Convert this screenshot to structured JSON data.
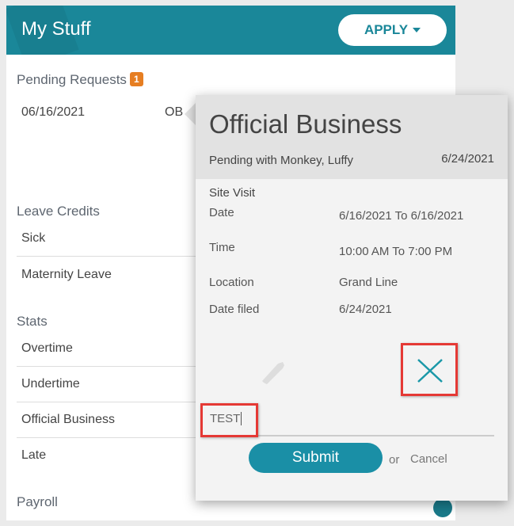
{
  "header": {
    "title": "My Stuff",
    "apply_label": "APPLY"
  },
  "pending": {
    "title": "Pending Requests",
    "count": "1",
    "items": [
      {
        "date": "06/16/2021",
        "type": "OB"
      }
    ]
  },
  "leave_credits": {
    "title": "Leave Credits",
    "items": [
      "Sick",
      "Maternity Leave"
    ]
  },
  "stats": {
    "title": "Stats",
    "items": [
      "Overtime",
      "Undertime",
      "Official Business",
      "Late"
    ]
  },
  "payroll": {
    "title": "Payroll"
  },
  "popup": {
    "title": "Official Business",
    "status": "Pending with Monkey, Luffy",
    "filed_date": "6/24/2021",
    "subtitle": "Site Visit",
    "fields": [
      {
        "label": "Date",
        "value": "6/16/2021 To 6/16/2021"
      },
      {
        "label": "Time",
        "value": "10:00 AM To 7:00 PM"
      },
      {
        "label": "Location",
        "value": "Grand Line"
      },
      {
        "label": "Date filed",
        "value": "6/24/2021"
      }
    ],
    "comment_value": "TEST",
    "submit_label": "Submit",
    "or_label": "or",
    "cancel_label": "Cancel"
  },
  "colors": {
    "accent": "#1a8799",
    "badge": "#e67e22",
    "highlight": "#e53935"
  }
}
